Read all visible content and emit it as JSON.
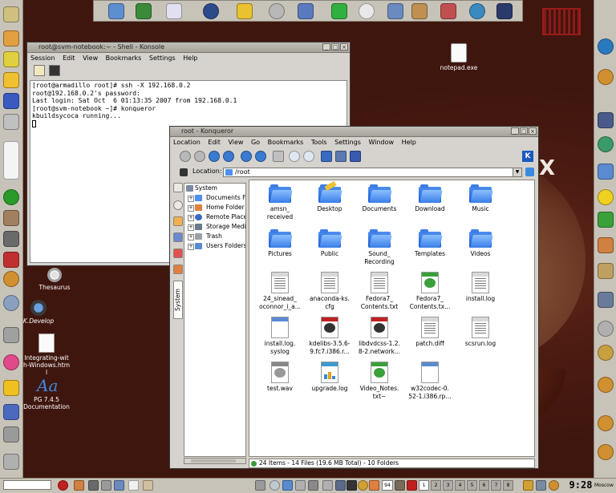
{
  "desktop": {
    "icons": [
      {
        "label": "notepad.exe",
        "icon": "document-icon"
      },
      {
        "label": "Thesaurus",
        "icon": "gear-icon"
      },
      {
        "label": "K.Develop",
        "icon": "kdevelop-icon"
      },
      {
        "label": "Integrating-with-Windows.html",
        "icon": "html-document-icon"
      },
      {
        "label": "PG 7.4.5 Documentation",
        "icon": "font-icon"
      }
    ]
  },
  "konsole": {
    "title": "root@svm-notebook:~ - Shell - Konsole",
    "menu": [
      "Session",
      "Edit",
      "View",
      "Bookmarks",
      "Settings",
      "Help"
    ],
    "lines": [
      "[root@armadillo root]# ssh -X 192.168.0.2",
      "root@192.168.0.2's password:",
      "Last login: Sat Oct  6 01:13:35 2007 from 192.168.0.1",
      "[root@svm-notebook ~]# konqueror",
      "kbuildsycoca running...",
      ""
    ]
  },
  "konqueror": {
    "title": "root - Konqueror",
    "menu": [
      "Location",
      "Edit",
      "View",
      "Go",
      "Bookmarks",
      "Tools",
      "Settings",
      "Window",
      "Help"
    ],
    "location_label": "Location:",
    "location_value": "/root",
    "sidebar_tab": "System",
    "tree": {
      "root": "System",
      "items": [
        "Documents Fo",
        "Home Folder",
        "Remote Places",
        "Storage Media",
        "Trash",
        "Users Folders"
      ]
    },
    "files": [
      {
        "name": "amsn_\nreceived",
        "kind": "folder"
      },
      {
        "name": "Desktop",
        "kind": "desktop-folder"
      },
      {
        "name": "Documents",
        "kind": "folder"
      },
      {
        "name": "Download",
        "kind": "folder"
      },
      {
        "name": "Music",
        "kind": "folder"
      },
      {
        "name": "Pictures",
        "kind": "folder"
      },
      {
        "name": "Public",
        "kind": "folder"
      },
      {
        "name": "Sound_\nRecording",
        "kind": "folder"
      },
      {
        "name": "Templates",
        "kind": "folder"
      },
      {
        "name": "Videos",
        "kind": "folder"
      },
      {
        "name": "24_sinead_\noconnor_i_a...",
        "kind": "text"
      },
      {
        "name": "anaconda-ks.\ncfg",
        "kind": "text"
      },
      {
        "name": "Fedora7_\nContents.txt",
        "kind": "text"
      },
      {
        "name": "Fedora7_\nContents.tx...",
        "kind": "green"
      },
      {
        "name": "install.log",
        "kind": "text"
      },
      {
        "name": "install.log.\nsyslog",
        "kind": "blank"
      },
      {
        "name": "kdelibs-3.5.6-\n9.fc7.i386.r...",
        "kind": "rpm"
      },
      {
        "name": "libdvdcss-1.2.\n8-2.network...",
        "kind": "rpm"
      },
      {
        "name": "patch.diff",
        "kind": "text"
      },
      {
        "name": "scsrun.log",
        "kind": "text"
      },
      {
        "name": "test.wav",
        "kind": "audio"
      },
      {
        "name": "upgrade.log",
        "kind": "chart"
      },
      {
        "name": "Video_Notes.\ntxt~",
        "kind": "green"
      },
      {
        "name": "w32codec-0.\n52-1.i386.rp...",
        "kind": "blank"
      }
    ],
    "status": "24 Items - 14 Files (19.6 MB Total) - 10 Folders"
  },
  "taskbar": {
    "pager": [
      "1",
      "2",
      "3",
      "4",
      "5",
      "6",
      "7",
      "8"
    ],
    "counter": "94",
    "clock": "9:28",
    "city": "Moscow"
  },
  "colors": {
    "desktop": "#4a1c12",
    "panel": "#c8c3b8",
    "folder_blue": "#3a7de8"
  }
}
